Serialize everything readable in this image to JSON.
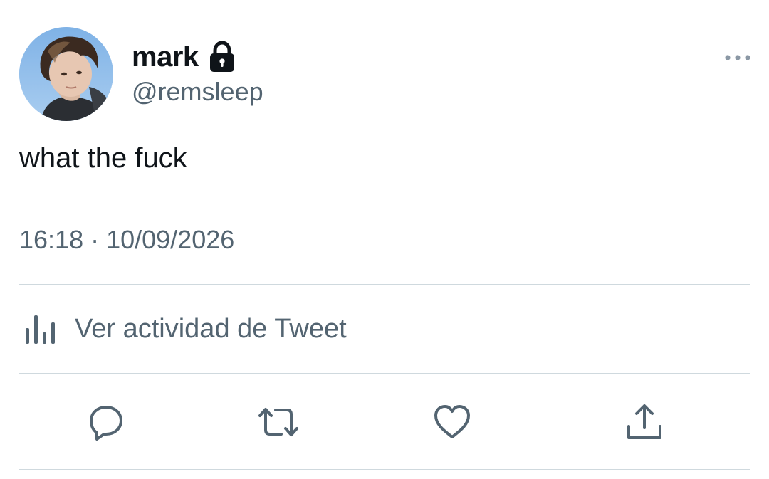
{
  "user": {
    "display_name": "mark",
    "handle": "@remsleep",
    "protected_icon": "lock-icon",
    "avatar_alt": "profile photo"
  },
  "tweet": {
    "text": "what the fuck",
    "timestamp": "16:18 · 10/09/2026"
  },
  "activity": {
    "label": "Ver actividad de Tweet",
    "icon": "bar-chart-icon"
  },
  "actions": {
    "reply_icon": "reply-icon",
    "retweet_icon": "retweet-icon",
    "like_icon": "heart-icon",
    "share_icon": "share-icon",
    "more_icon": "more-icon"
  },
  "colors": {
    "primary_text": "#0f1419",
    "secondary_text": "#536471",
    "divider": "#cfd9de"
  }
}
